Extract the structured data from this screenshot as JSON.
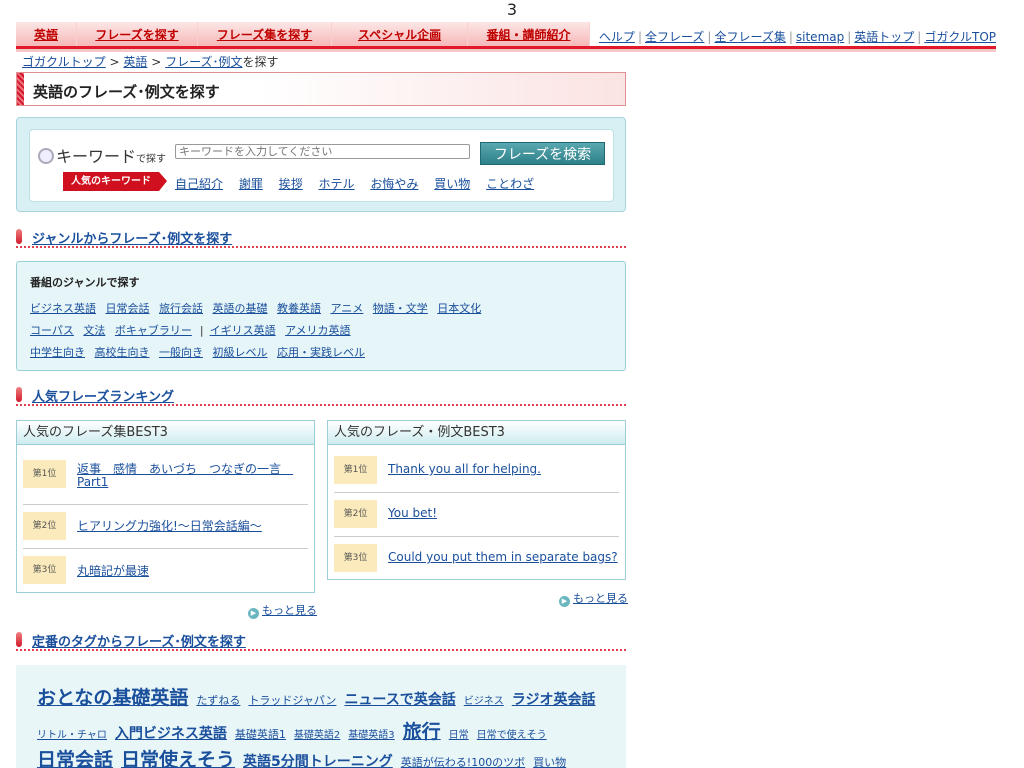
{
  "page_number": "3",
  "nav_tabs": [
    {
      "label": "英語"
    },
    {
      "label": "フレーズを探す"
    },
    {
      "label": "フレーズ集を探す"
    },
    {
      "label": "スペシャル企画"
    },
    {
      "label": "番組・講師紹介"
    }
  ],
  "top_links": [
    "ヘルプ",
    "全フレーズ",
    "全フレーズ集",
    "sitemap",
    "英語トップ",
    "ゴガクルTOP"
  ],
  "breadcrumb": {
    "items": [
      "ゴガクルトップ",
      "英語",
      "フレーズ･例文"
    ],
    "current": "を探す",
    "sep": ">"
  },
  "page_title": "英語のフレーズ･例文を探す",
  "search": {
    "label": "キーワード",
    "label_small": "で探す",
    "placeholder": "キーワードを入力してください",
    "button": "フレーズを検索",
    "popular_label": "人気のキーワード",
    "popular_keywords": [
      "自己紹介",
      "謝罪",
      "挨拶",
      "ホテル",
      "お悔やみ",
      "買い物",
      "ことわざ"
    ]
  },
  "genre_section": {
    "heading": "ジャンルからフレーズ･例文を探す",
    "box_title": "番組のジャンルで探す",
    "row1": [
      "ビジネス英語",
      "日常会話",
      "旅行会話",
      "英語の基礎",
      "教養英語",
      "アニメ",
      "物語・文学",
      "日本文化"
    ],
    "row2a": [
      "コーパス",
      "文法",
      "ボキャブラリー"
    ],
    "row2_sep": "|",
    "row2b": [
      "イギリス英語",
      "アメリカ英語"
    ],
    "row3": [
      "中学生向き",
      "高校生向き",
      "一般向き",
      "初級レベル",
      "応用・実践レベル"
    ]
  },
  "ranking_section": {
    "heading": "人気フレーズランキング",
    "left": {
      "title": "人気のフレーズ集BEST3",
      "items": [
        {
          "rank": "第1位",
          "line1": "返事　感情　あいづち　つなぎの一言　",
          "line2": "Part1"
        },
        {
          "rank": "第2位",
          "line1": "ヒアリング力強化!〜日常会話編〜",
          "line2": ""
        },
        {
          "rank": "第3位",
          "line1": "丸暗記が最速",
          "line2": ""
        }
      ],
      "more": "もっと見る"
    },
    "right": {
      "title": "人気のフレーズ・例文BEST3",
      "items": [
        {
          "rank": "第1位",
          "text": "Thank you all for helping."
        },
        {
          "rank": "第2位",
          "text": "You bet!"
        },
        {
          "rank": "第3位",
          "text": "Could you put them in separate bags?"
        }
      ],
      "more": "もっと見る"
    }
  },
  "tag_section": {
    "heading": "定番のタグからフレーズ･例文を探す",
    "row1": [
      {
        "text": "おとなの基礎英語",
        "size": 19
      },
      {
        "text": "たずねる",
        "size": 11
      },
      {
        "text": "トラッドジャパン",
        "size": 11
      },
      {
        "text": "ニュースで英会話",
        "size": 14
      },
      {
        "text": "ビジネス",
        "size": 10
      },
      {
        "text": "ラジオ英会話",
        "size": 14
      }
    ],
    "row2": [
      {
        "text": "リトル・チャロ",
        "size": 10
      },
      {
        "text": "入門ビジネス英語",
        "size": 14
      },
      {
        "text": "基礎英語1",
        "size": 11
      },
      {
        "text": "基礎英語2",
        "size": 10
      },
      {
        "text": "基礎英語3",
        "size": 10
      },
      {
        "text": "旅行",
        "size": 19
      },
      {
        "text": "日常",
        "size": 10
      },
      {
        "text": "日常で使えそう",
        "size": 10
      }
    ],
    "row3": [
      {
        "text": "日常会話",
        "size": 19
      },
      {
        "text": "日常使えそう",
        "size": 19
      },
      {
        "text": "英語5分間トレーニング",
        "size": 14
      },
      {
        "text": "英語が伝わる!100のツボ",
        "size": 11
      },
      {
        "text": "買い物",
        "size": 11
      }
    ]
  },
  "colors": {
    "accent_red": "#e01a2a",
    "link": "#1a4f9c",
    "teal_box": "#e6f5f7",
    "rank_badge": "#fbeabb"
  }
}
